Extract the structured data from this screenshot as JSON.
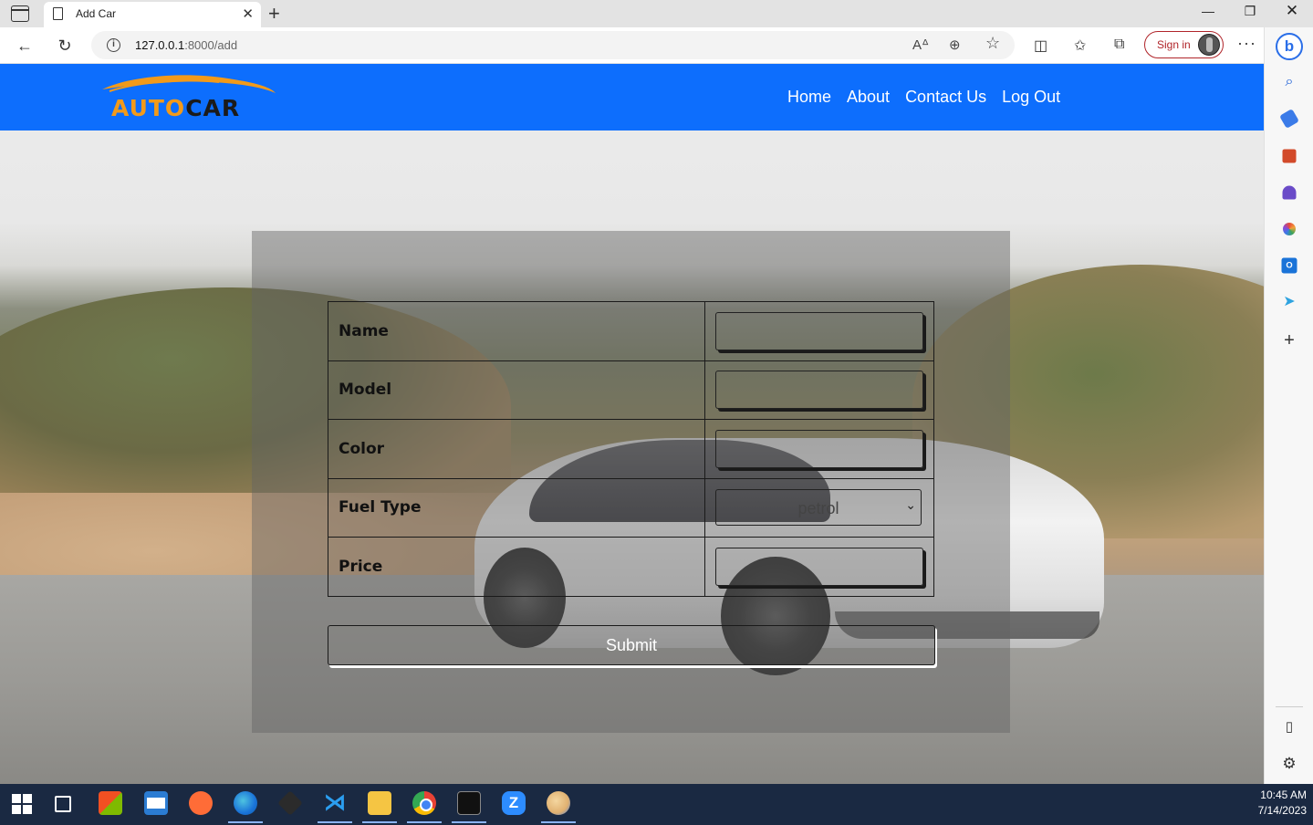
{
  "browser": {
    "tab_title": "Add Car",
    "url_host": "127.0.0.1",
    "url_path": ":8000/add",
    "signin_label": "Sign in"
  },
  "site": {
    "logo": {
      "part1": "AUTO",
      "part2": "CAR"
    },
    "nav": [
      "Home",
      "About",
      "Contact Us",
      "Log Out"
    ],
    "colors": {
      "header_bg": "#0d6efd",
      "logo_orange": "#f29a1a"
    }
  },
  "form": {
    "fields": [
      {
        "label": "Name",
        "type": "text",
        "value": ""
      },
      {
        "label": "Model",
        "type": "text",
        "value": ""
      },
      {
        "label": "Color",
        "type": "text",
        "value": ""
      },
      {
        "label": "Fuel Type",
        "type": "select",
        "value": "petrol"
      },
      {
        "label": "Price",
        "type": "text",
        "value": ""
      }
    ],
    "submit_label": "Submit"
  },
  "taskbar": {
    "time": "10:45 AM",
    "date": "7/14/2023"
  }
}
